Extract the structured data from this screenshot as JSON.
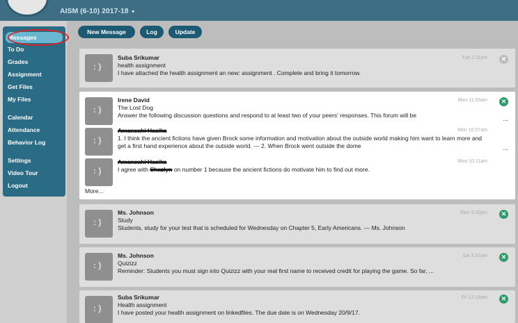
{
  "header": {
    "school_label": "AISM (6-10)  2017-18"
  },
  "sidebar": {
    "items": [
      {
        "label": "Messages"
      },
      {
        "label": "To Do"
      },
      {
        "label": "Grades"
      },
      {
        "label": "Assignment"
      },
      {
        "label": "Get Files"
      },
      {
        "label": "My Files"
      },
      {
        "label": "Calendar"
      },
      {
        "label": "Attendance"
      },
      {
        "label": "Behavior Log"
      },
      {
        "label": "Settings"
      },
      {
        "label": "Video Tour"
      },
      {
        "label": "Logout"
      }
    ]
  },
  "toolbar": {
    "new_message": "New Message",
    "log": "Log",
    "update": "Update"
  },
  "messages": [
    {
      "sender": "Suba Srikumar",
      "subject": "health assignment",
      "body": "I have attached the health assignment an new: assignment . Complete and bring it tomorrow.",
      "time": "Tue 2:11am"
    },
    {
      "sender": "Irene David",
      "subject": "The Lost Dog",
      "body": "Answer the following discussion questions and respond to at least two of your peers' responses. This forum will be",
      "time": "Mon 11:55am",
      "replies": [
        {
          "sender": "Amansahi Hasika",
          "body": "1. I think the ancient fictions have given Brock some information and motivation about the outside world making him want to learn more and get a first hand experience about the outside world. --- 2. When Brock went outside the dome",
          "time": "Mon 10:07am"
        },
        {
          "sender": "Amansahi Hasika",
          "body_prefix": "I agree with",
          "body_name": "Shazlyn",
          "body_suffix": "on number 1 because the ancient fictions do motivate him to find out more.",
          "time": "Mon 10:11am"
        }
      ],
      "more_label": "More..."
    },
    {
      "sender": "Ms. Johnson",
      "subject": "Study",
      "body": "Students, study for your test that is scheduled  for Wednesday on Chapter 5, Early Americans. --- Ms. Johnson",
      "time": "Mon 3:42pm"
    },
    {
      "sender": "Ms. Johnson",
      "subject": "Quizizz",
      "body": "Reminder: Students you must sign into Quizizz with your real first name to received credit for playing the game. So far, ...",
      "time": "Sat 3:37am"
    },
    {
      "sender": "Suba Srikumar",
      "subject": "Health assignment",
      "body": "I have posted your health assignment on linkedfiles. The due date is on Wednesday 20/9/17.",
      "time": "Fri 12:18am"
    }
  ],
  "icons": {
    "avatar": "smiley-avatar-icon",
    "dismiss": "close-icon",
    "school_caret": "chevron-down-icon"
  },
  "colors": {
    "topbar": "#3d6e84",
    "sidebar": "#2a6c85",
    "active_item": "#68b6cf",
    "button": "#1c5a73",
    "highlight_ring": "#d92323",
    "dismiss": "#2f9a6a"
  },
  "ellipsis": "..."
}
